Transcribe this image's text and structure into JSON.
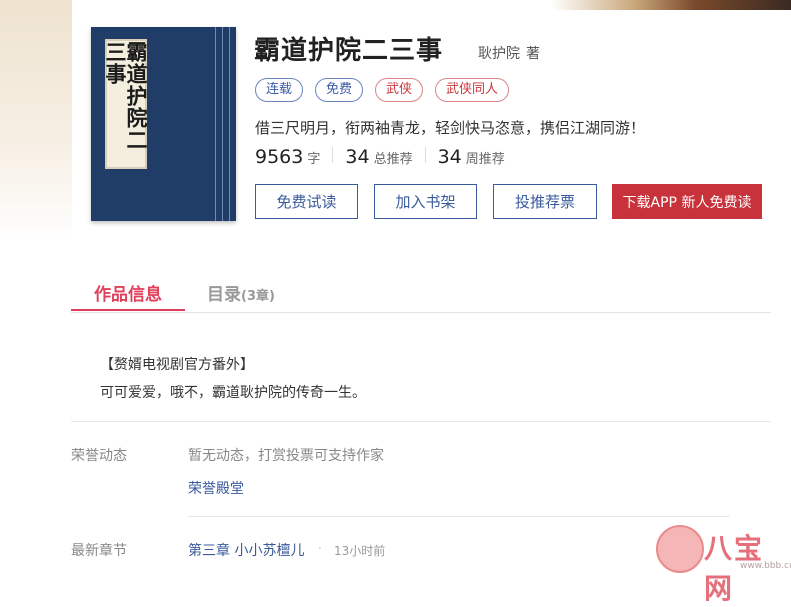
{
  "book": {
    "cover_text": "霸道护院二三事",
    "title": "霸道护院二三事",
    "author": "耿护院",
    "author_suffix": "著",
    "tags": [
      "连载",
      "免费",
      "武侠",
      "武侠同人"
    ],
    "description": "借三尺明月，衔两袖青龙，轻剑快马恣意，携侣江湖同游！",
    "stats": {
      "words_num": "9563",
      "words_unit": "字",
      "total_rec_num": "34",
      "total_rec_label": "总推荐",
      "week_rec_num": "34",
      "week_rec_label": "周推荐"
    }
  },
  "buttons": {
    "free_read": "免费试读",
    "add_shelf": "加入书架",
    "vote": "投推荐票",
    "download": "下载APP  新人免费读"
  },
  "tabs": {
    "info": "作品信息",
    "toc": "目录",
    "toc_count": "(3章)"
  },
  "intro": {
    "line1": "【赘婿电视剧官方番外】",
    "line2": "可可爱爱，哦不，霸道耿护院的传奇一生。"
  },
  "honor": {
    "label": "荣誉动态",
    "text": "暂无动态，打赏投票可支持作家",
    "link": "荣誉殿堂"
  },
  "latest": {
    "label": "最新章节",
    "chapter": "第三章  小小苏檀儿",
    "dot": "·",
    "time": "13小时前"
  },
  "watermark": {
    "text": "八宝网",
    "url": "www.bbb.com"
  }
}
